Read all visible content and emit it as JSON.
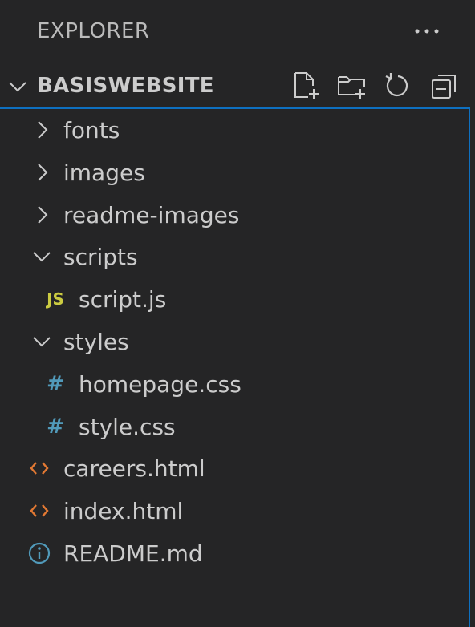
{
  "explorer": {
    "title": "EXPLORER",
    "more_actions_label": "..."
  },
  "section": {
    "title": "BASISWEBSITE",
    "actions": [
      {
        "name": "new-file",
        "icon": "new-file-icon"
      },
      {
        "name": "new-folder",
        "icon": "new-folder-icon"
      },
      {
        "name": "refresh",
        "icon": "refresh-icon"
      },
      {
        "name": "collapse-all",
        "icon": "collapse-all-icon"
      }
    ]
  },
  "tree": {
    "items": [
      {
        "label": "fonts",
        "type": "folder",
        "expanded": false,
        "depth": 0
      },
      {
        "label": "images",
        "type": "folder",
        "expanded": false,
        "depth": 0
      },
      {
        "label": "readme-images",
        "type": "folder",
        "expanded": false,
        "depth": 0
      },
      {
        "label": "scripts",
        "type": "folder",
        "expanded": true,
        "depth": 0
      },
      {
        "label": "script.js",
        "type": "file",
        "icon_text": "JS",
        "depth": 1
      },
      {
        "label": "styles",
        "type": "folder",
        "expanded": true,
        "depth": 0
      },
      {
        "label": "homepage.css",
        "type": "file",
        "icon_text": "#",
        "depth": 1
      },
      {
        "label": "style.css",
        "type": "file",
        "icon_text": "#",
        "depth": 1
      },
      {
        "label": "careers.html",
        "type": "file",
        "icon_text": "<>",
        "depth": 0
      },
      {
        "label": "index.html",
        "type": "file",
        "icon_text": "<>",
        "depth": 0
      },
      {
        "label": "README.md",
        "type": "file",
        "icon_text": "i",
        "depth": 0
      }
    ]
  },
  "colors": {
    "background": "#252526",
    "text": "#cccccc",
    "focus_border": "#0e70c0",
    "js": "#cbcb41",
    "css": "#519aba",
    "html": "#e37933",
    "info": "#519aba"
  }
}
